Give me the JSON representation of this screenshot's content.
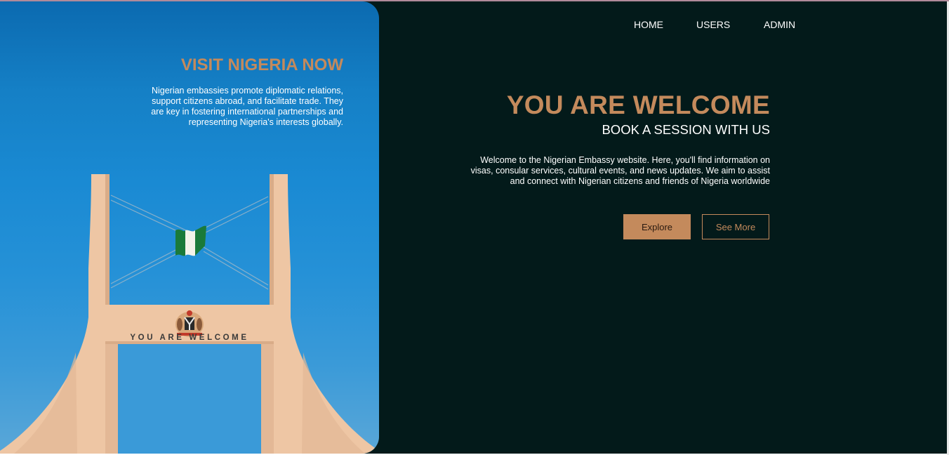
{
  "nav": {
    "items": [
      {
        "label": "HOME"
      },
      {
        "label": "USERS"
      },
      {
        "label": "ADMIN"
      }
    ]
  },
  "hero": {
    "title": "VISIT NIGERIA NOW",
    "text": "Nigerian embassies promote diplomatic relations, support citizens abroad, and facilitate trade. They are key in fostering international partnerships and representing Nigeria's interests globally.",
    "gate_inscription": "YOU ARE WELCOME"
  },
  "main": {
    "title": "YOU ARE WELCOME",
    "subtitle": "BOOK A SESSION WITH US",
    "text": "Welcome to the Nigerian Embassy website. Here, you'll find information on visas, consular services, cultural events, and news updates. We aim to assist and connect with Nigerian citizens and friends of Nigeria worldwide",
    "buttons": {
      "explore": "Explore",
      "see_more": "See More"
    }
  },
  "colors": {
    "accent": "#c48a5c",
    "background": "#031a1a",
    "sky_top": "#0b6ab0",
    "sky_bottom": "#5aa7d8",
    "gate": "#eec6a4"
  }
}
